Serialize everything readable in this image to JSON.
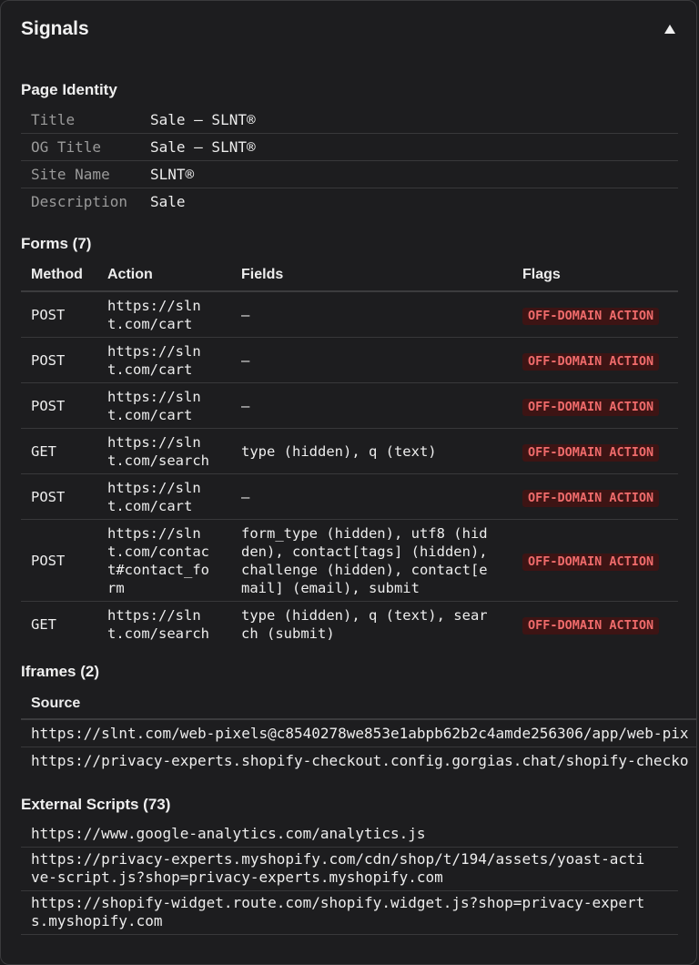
{
  "header": {
    "title": "Signals",
    "toggle_icon": "collapse-triangle-up-icon"
  },
  "identity": {
    "title": "Page Identity",
    "rows": [
      {
        "key": "Title",
        "value": "Sale – SLNT®"
      },
      {
        "key": "OG Title",
        "value": "Sale – SLNT®"
      },
      {
        "key": "Site Name",
        "value": "SLNT®"
      },
      {
        "key": "Description",
        "value": "Sale"
      }
    ]
  },
  "forms": {
    "title": "Forms (7)",
    "headers": {
      "method": "Method",
      "action": "Action",
      "fields": "Fields",
      "flags": "Flags"
    },
    "flag_color": "#ef6b6b",
    "flag_bg": "#3d1414",
    "rows": [
      {
        "method": "POST",
        "action": "https://sln\nt.com/cart",
        "fields": "–",
        "flag": "OFF-DOMAIN ACTION"
      },
      {
        "method": "POST",
        "action": "https://sln\nt.com/cart",
        "fields": "–",
        "flag": "OFF-DOMAIN ACTION"
      },
      {
        "method": "POST",
        "action": "https://sln\nt.com/cart",
        "fields": "–",
        "flag": "OFF-DOMAIN ACTION"
      },
      {
        "method": "GET",
        "action": "https://sln\nt.com/search",
        "fields": "type (hidden), q (text)",
        "flag": "OFF-DOMAIN ACTION"
      },
      {
        "method": "POST",
        "action": "https://sln\nt.com/cart",
        "fields": "–",
        "flag": "OFF-DOMAIN ACTION"
      },
      {
        "method": "POST",
        "action": "https://sln\nt.com/contac\nt#contact_fo\nrm",
        "fields": "form_type (hidden), utf8 (hid\nden), contact[tags] (hidden),\nchallenge (hidden), contact[e\nmail] (email), submit",
        "flag": "OFF-DOMAIN ACTION"
      },
      {
        "method": "GET",
        "action": "https://sln\nt.com/search",
        "fields": "type (hidden), q (text), sear\nch (submit)",
        "flag": "OFF-DOMAIN ACTION"
      }
    ]
  },
  "iframes": {
    "title": "Iframes (2)",
    "header": "Source",
    "rows": [
      "https://slnt.com/web-pixels@c8540278we853e1abpb62b2c4amde256306/app/web-pix",
      "https://privacy-experts.shopify-checkout.config.gorgias.chat/shopify-checko"
    ]
  },
  "scripts": {
    "title": "External Scripts (73)",
    "rows": [
      "https://www.google-analytics.com/analytics.js",
      "https://privacy-experts.myshopify.com/cdn/shop/t/194/assets/yoast-acti\nve-script.js?shop=privacy-experts.myshopify.com",
      "https://shopify-widget.route.com/shopify.widget.js?shop=privacy-expert\ns.myshopify.com"
    ]
  }
}
